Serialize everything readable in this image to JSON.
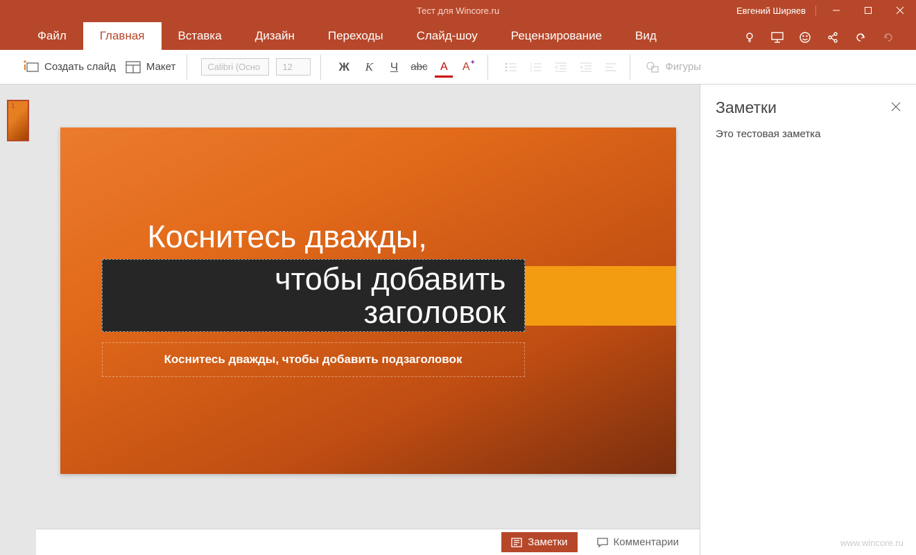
{
  "titlebar": {
    "document_title": "Тест для Wincore.ru",
    "user_name": "Евгений Ширяев"
  },
  "menu": {
    "tabs": {
      "file": "Файл",
      "home": "Главная",
      "insert": "Вставка",
      "design": "Дизайн",
      "transitions": "Переходы",
      "slideshow": "Слайд-шоу",
      "review": "Рецензирование",
      "view": "Вид"
    }
  },
  "ribbon": {
    "new_slide": "Создать слайд",
    "layout": "Макет",
    "font_name": "Calibri (Осно",
    "font_size": "12",
    "bold": "Ж",
    "italic": "К",
    "underline": "Ч",
    "strike": "abc",
    "font_color": "А",
    "clear_format": "А",
    "shapes": "Фигуры"
  },
  "thumbnails": {
    "slide1_num": "1"
  },
  "slide": {
    "title_line1": "Коснитесь дважды,",
    "title_line2": "чтобы добавить",
    "title_line3": "заголовок",
    "subtitle": "Коснитесь дважды, чтобы добавить подзаголовок"
  },
  "notes": {
    "title": "Заметки",
    "content": "Это тестовая заметка"
  },
  "statusbar": {
    "notes_btn": "Заметки",
    "comments_btn": "Комментарии",
    "watermark": "www.wincore.ru"
  }
}
